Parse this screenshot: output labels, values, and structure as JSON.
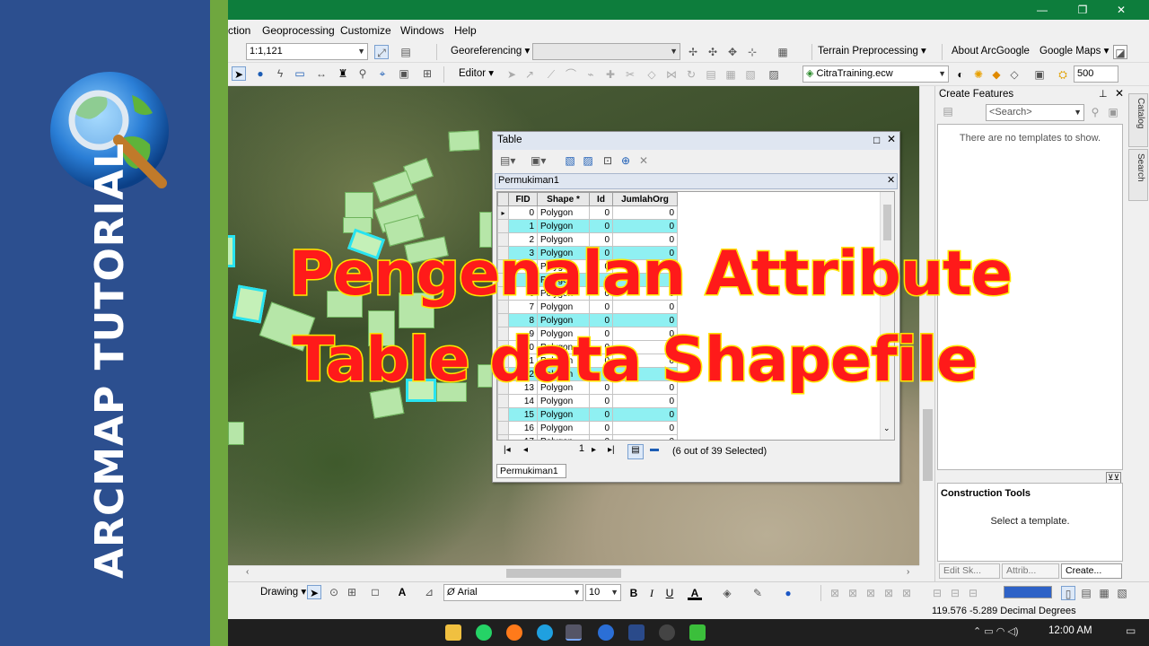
{
  "brand": {
    "title": "ARCMAP TUTORIAL",
    "colors": {
      "panel": "#2c4f8f",
      "strip": "#6fa73f"
    }
  },
  "window": {
    "controls": {
      "minimize": "—",
      "maximize": "❐",
      "close": "✕"
    }
  },
  "menubar": [
    "ction",
    "Geoprocessing",
    "Customize",
    "Windows",
    "Help"
  ],
  "toolbar1": {
    "scale_value": "1:1,121",
    "georeferencing_label": "Georeferencing ▾",
    "terrain_label": "Terrain Preprocessing ▾",
    "about_google_label": "About ArcGoogle",
    "google_maps_label": "Google Maps ▾"
  },
  "toolbar2": {
    "editor_label": "Editor ▾",
    "layer_value": "CitraTraining.ecw",
    "value_500": "500"
  },
  "create_features": {
    "title": "Create Features",
    "search_placeholder": "<Search>",
    "no_templates": "There are no templates to show."
  },
  "construction_tools": {
    "title": "Construction Tools",
    "message": "Select a template."
  },
  "dock_tabs": [
    "Edit Sk...",
    "Attrib...",
    "Create..."
  ],
  "side_tabs": [
    "Catalog",
    "Search"
  ],
  "table_window": {
    "title": "Table",
    "layer_tab": "Permukiman1",
    "columns": [
      "FID",
      "Shape *",
      "Id",
      "JumlahOrg"
    ],
    "rows": [
      {
        "fid": "0",
        "shape": "Polygon",
        "id": "0",
        "jumlah": "0",
        "selected": false,
        "current": true
      },
      {
        "fid": "1",
        "shape": "Polygon",
        "id": "0",
        "jumlah": "0",
        "selected": true
      },
      {
        "fid": "2",
        "shape": "Polygon",
        "id": "0",
        "jumlah": "0",
        "selected": false
      },
      {
        "fid": "3",
        "shape": "Polygon",
        "id": "0",
        "jumlah": "0",
        "selected": true
      },
      {
        "fid": "4",
        "shape": "Polygon",
        "id": "0",
        "jumlah": "0",
        "selected": false
      },
      {
        "fid": "5",
        "shape": "Polygon",
        "id": "0",
        "jumlah": "0",
        "selected": true
      },
      {
        "fid": "6",
        "shape": "Polygon",
        "id": "0",
        "jumlah": "0",
        "selected": false
      },
      {
        "fid": "7",
        "shape": "Polygon",
        "id": "0",
        "jumlah": "0",
        "selected": false
      },
      {
        "fid": "8",
        "shape": "Polygon",
        "id": "0",
        "jumlah": "0",
        "selected": true
      },
      {
        "fid": "9",
        "shape": "Polygon",
        "id": "0",
        "jumlah": "0",
        "selected": false
      },
      {
        "fid": "10",
        "shape": "Polygon",
        "id": "0",
        "jumlah": "0",
        "selected": false
      },
      {
        "fid": "11",
        "shape": "Polygon",
        "id": "0",
        "jumlah": "0",
        "selected": false
      },
      {
        "fid": "12",
        "shape": "Polygon",
        "id": "0",
        "jumlah": "0",
        "selected": true
      },
      {
        "fid": "13",
        "shape": "Polygon",
        "id": "0",
        "jumlah": "0",
        "selected": false
      },
      {
        "fid": "14",
        "shape": "Polygon",
        "id": "0",
        "jumlah": "0",
        "selected": false
      },
      {
        "fid": "15",
        "shape": "Polygon",
        "id": "0",
        "jumlah": "0",
        "selected": true
      },
      {
        "fid": "16",
        "shape": "Polygon",
        "id": "0",
        "jumlah": "0",
        "selected": false
      },
      {
        "fid": "17",
        "shape": "Polygon",
        "id": "0",
        "jumlah": "0",
        "selected": false
      }
    ],
    "nav_record": "1",
    "selection_status": "(6 out of 39 Selected)",
    "bottom_tab": "Permukiman1",
    "colors": {
      "selected_row": "#8ff0f2"
    }
  },
  "drawing_toolbar": {
    "drawing_label": "Drawing ▾",
    "font_value": "Arial",
    "font_size_value": "10"
  },
  "status": {
    "coordinates": "119.576  -5.289 Decimal Degrees"
  },
  "taskbar": {
    "time": "12:00 AM"
  },
  "headline": {
    "line1": "Pengenalan Attribute",
    "line2": "Table data Shapefile",
    "colors": {
      "fill": "#ff1a1a",
      "outline": "#ffe400"
    }
  },
  "icons": [
    "globe-magnifier-icon",
    "select-arrow-icon",
    "identify-icon",
    "close-icon",
    "pin-icon",
    "first-record-icon",
    "prev-record-icon",
    "next-record-icon",
    "last-record-icon",
    "show-all-records-icon",
    "show-selected-records-icon",
    "bold-icon",
    "italic-icon",
    "underline-icon",
    "clock-icon"
  ]
}
